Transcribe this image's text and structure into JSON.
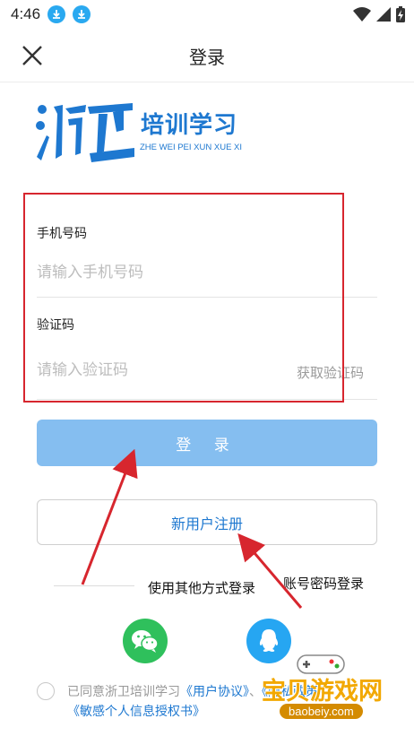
{
  "status_bar": {
    "time": "4:46"
  },
  "header": {
    "title": "登录"
  },
  "logo": {
    "cn": "培训学习",
    "en": "ZHE WEI PEI XUN XUE XI",
    "mark": "浙卫"
  },
  "form": {
    "phone_label": "手机号码",
    "phone_placeholder": "请输入手机号码",
    "code_label": "验证码",
    "code_placeholder": "请输入验证码",
    "get_code": "获取验证码"
  },
  "buttons": {
    "login": "登 录",
    "register": "新用户注册"
  },
  "other": {
    "label": "使用其他方式登录",
    "password_login": "账号密码登录"
  },
  "agreement": {
    "prefix": "已同意浙卫培训学习",
    "user_agreement": "《用户协议》",
    "and": "、",
    "privacy": "《隐私政策》",
    "sensitive": "《敏感个人信息授权书》"
  },
  "watermark": {
    "text": "宝贝游戏网",
    "url": "baobeiy.com"
  },
  "colors": {
    "brand": "#1e78d0",
    "login_button": "#85bef0",
    "annotation": "#d7262e",
    "wechat": "#2fc05c",
    "qq": "#26a6f2"
  }
}
